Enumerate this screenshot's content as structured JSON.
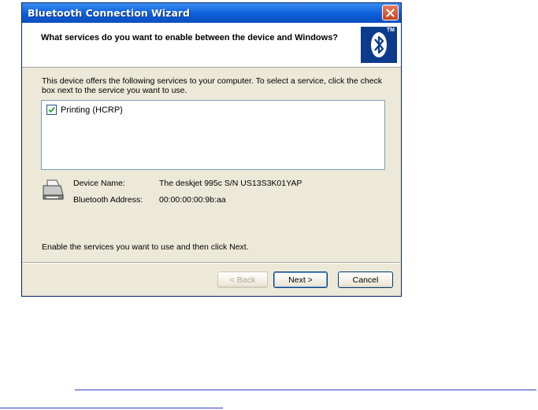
{
  "window": {
    "title": "Bluetooth Connection Wizard",
    "question": "What services do you want to enable between the device and Windows?",
    "logo_tm": "TM"
  },
  "content": {
    "description": "This device offers the following services to your computer. To select a service, click the check box next to the service you want to use.",
    "services": [
      {
        "label": "Printing (HCRP)",
        "checked": true
      }
    ],
    "device": {
      "name_label": "Device Name:",
      "name_value": "The deskjet 995c S/N US13S3K01YAP",
      "address_label": "Bluetooth Address:",
      "address_value": "00:00:00:00:9b:aa"
    },
    "instruction": "Enable the services you want to use and then click Next."
  },
  "buttons": {
    "back": "< Back",
    "next": "Next >",
    "cancel": "Cancel"
  },
  "colors": {
    "titlebar": "#0a5fd8",
    "dialog_bg": "#ece9d8",
    "bluetooth_logo_bg": "#0c3b8c",
    "link_line": "#2c3fbf"
  }
}
